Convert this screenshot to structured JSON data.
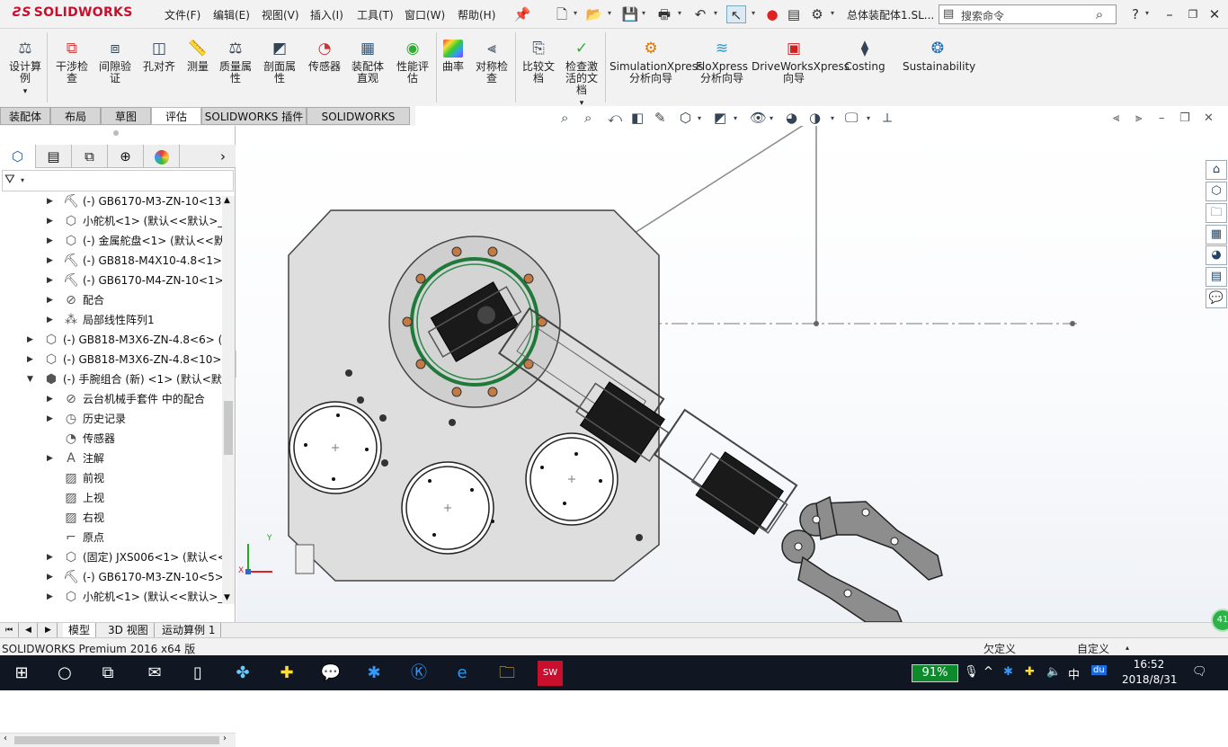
{
  "app": {
    "logo_text": "SOLIDWORKS",
    "doc_title": "总体装配体1.SL..."
  },
  "menu": [
    "文件(F)",
    "编辑(E)",
    "视图(V)",
    "插入(I)",
    "工具(T)",
    "窗口(W)",
    "帮助(H)"
  ],
  "search": {
    "placeholder": "搜索命令"
  },
  "ribbon": {
    "buttons": [
      "设计算例",
      "干涉检查",
      "间隙验证",
      "孔对齐",
      "测量",
      "质量属性",
      "剖面属性",
      "传感器",
      "装配体直观",
      "性能评估",
      "曲率",
      "对称检查",
      "比较文档",
      "检查激活的文档",
      "SimulationXpress 分析向导",
      "FloXpress 分析向导",
      "DriveWorksXpress 向导",
      "Costing",
      "Sustainability"
    ]
  },
  "tabs": [
    "装配体",
    "布局",
    "草图",
    "评估",
    "SOLIDWORKS 插件",
    "SOLIDWORKS MBD"
  ],
  "active_tab": "评估",
  "tree": [
    {
      "label": "(-) GB6170-M3-ZN-10<13",
      "icon": "bolt-icon",
      "level": 2
    },
    {
      "label": "小舵机<1> (默认<<默认>_!",
      "icon": "part-icon",
      "level": 2
    },
    {
      "label": "(-) 金属舵盘<1> (默认<<默",
      "icon": "part-icon",
      "level": 2
    },
    {
      "label": "(-) GB818-M4X10-4.8<1>",
      "icon": "bolt-icon",
      "level": 2
    },
    {
      "label": "(-) GB6170-M4-ZN-10<1>",
      "icon": "bolt-icon",
      "level": 2
    },
    {
      "label": "配合",
      "icon": "mate-icon",
      "level": 2
    },
    {
      "label": "局部线性阵列1",
      "icon": "pattern-icon",
      "level": 2
    },
    {
      "label": "(-) GB818-M3X6-ZN-4.8<6> (D",
      "icon": "part-icon",
      "level": 1
    },
    {
      "label": "(-) GB818-M3X6-ZN-4.8<10>",
      "icon": "part-icon",
      "level": 1
    },
    {
      "label": "(-) 手腕组合 (新) <1> (默认<默",
      "icon": "assembly-icon",
      "level": 1,
      "expanded": true
    },
    {
      "label": "云台机械手套件 中的配合",
      "icon": "mate-icon",
      "level": 2
    },
    {
      "label": "历史记录",
      "icon": "history-icon",
      "level": 2
    },
    {
      "label": "传感器",
      "icon": "sensor-icon",
      "level": 2,
      "no_arrow": true
    },
    {
      "label": "注解",
      "icon": "annotation-icon",
      "level": 2
    },
    {
      "label": "前视",
      "icon": "plane-icon",
      "level": 2,
      "no_arrow": true
    },
    {
      "label": "上视",
      "icon": "plane-icon",
      "level": 2,
      "no_arrow": true
    },
    {
      "label": "右视",
      "icon": "plane-icon",
      "level": 2,
      "no_arrow": true
    },
    {
      "label": "原点",
      "icon": "origin-icon",
      "level": 2,
      "no_arrow": true
    },
    {
      "label": "(固定) JXS006<1> (默认<<",
      "icon": "part-icon",
      "level": 2
    },
    {
      "label": "(-) GB6170-M3-ZN-10<5>",
      "icon": "bolt-icon",
      "level": 2
    },
    {
      "label": "小舵机<1> (默认<<默认>_!",
      "icon": "part-icon",
      "level": 2
    }
  ],
  "bottom_tabs": [
    "模型",
    "3D 视图",
    "运动算例 1"
  ],
  "status": {
    "product": "SOLIDWORKS Premium 2016 x64 版",
    "state": "欠定义",
    "units": "自定义"
  },
  "triad": {
    "x": "X",
    "y": "Y"
  },
  "taskbar": {
    "battery": "91%",
    "ime": "中",
    "time": "16:52",
    "date": "2018/8/31",
    "badge": "41"
  }
}
